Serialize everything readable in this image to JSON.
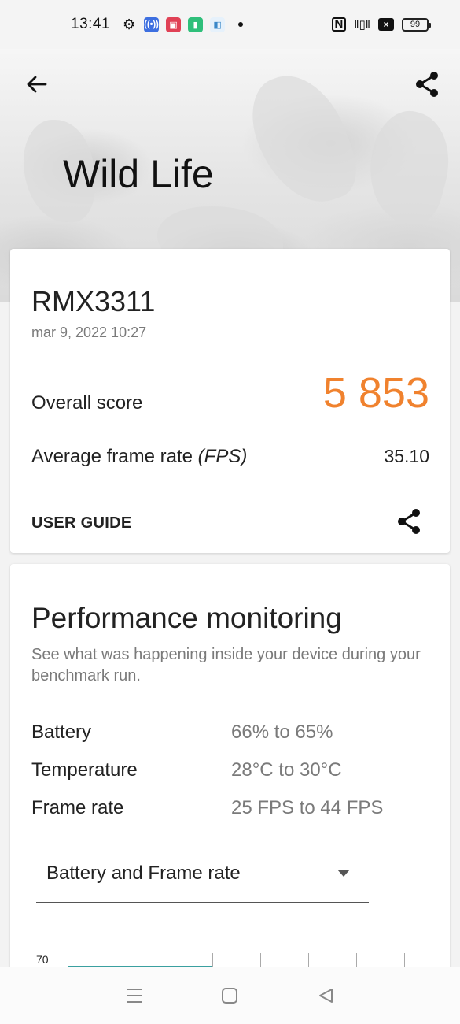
{
  "status_bar": {
    "time": "13:41",
    "battery": "99",
    "icons": [
      "gear-icon",
      "wifi-hotspot-icon",
      "app-icon-red",
      "app-icon-green",
      "app-icon-blue",
      "nfc-icon",
      "vibrate-icon",
      "no-sim-icon",
      "battery-icon"
    ]
  },
  "header": {
    "title": "Wild Life"
  },
  "result": {
    "device": "RMX3311",
    "date": "mar 9, 2022 10:27",
    "score_label": "Overall score",
    "score_value": "5 853",
    "fps_label_prefix": "Average frame rate ",
    "fps_label_unit": "(FPS)",
    "fps_value": "35.10",
    "guide_label": "USER GUIDE",
    "accent_color": "#f0822e"
  },
  "performance": {
    "title": "Performance monitoring",
    "description": "See what was happening inside your device during your benchmark run.",
    "rows": [
      {
        "label": "Battery",
        "value": "66% to 65%"
      },
      {
        "label": "Temperature",
        "value": "28°C to 30°C"
      },
      {
        "label": "Frame rate",
        "value": "25 FPS to 44 FPS"
      }
    ],
    "dropdown_selected": "Battery and Frame rate",
    "chart_top_tick": "70"
  }
}
